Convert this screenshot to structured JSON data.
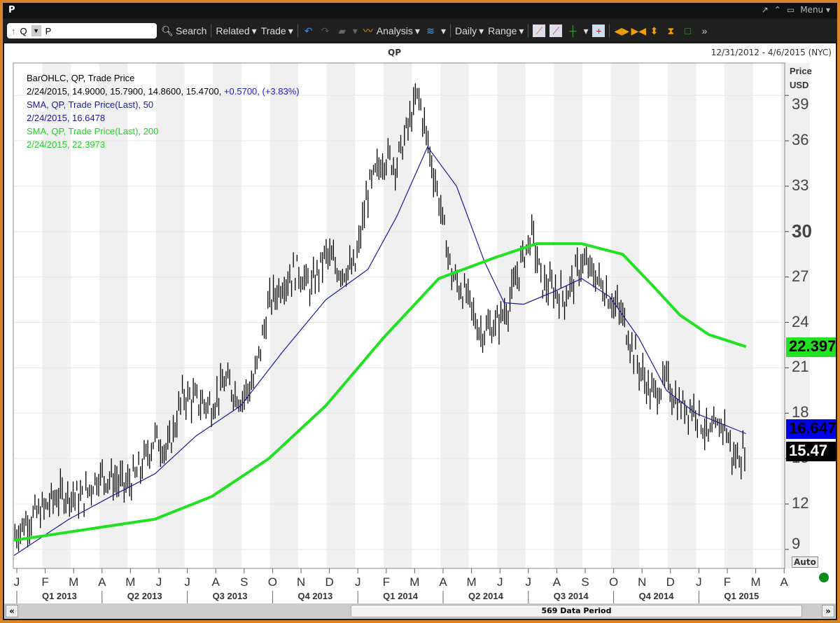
{
  "window": {
    "title": "P",
    "controls": [
      "↗",
      "⌃",
      "▭",
      "Menu ▾"
    ]
  },
  "toolbar": {
    "ticker_prefix": "Q",
    "ticker_value": "P",
    "search": "Search",
    "related": "Related",
    "trade": "Trade",
    "analysis": "Analysis",
    "daily": "Daily",
    "range": "Range"
  },
  "header": {
    "symbol": "QP",
    "date_range": "12/31/2012 - 4/6/2015 (NYC)"
  },
  "legend": {
    "l1": "BarOHLC, QP, Trade Price",
    "l2a": "2/24/2015, 14.9000, 15.7900, 14.8600, 15.4700, ",
    "l2b": "+0.5700, (+3.83%)",
    "l3": "SMA, QP, Trade Price(Last),  50",
    "l4": "2/24/2015, 16.6478",
    "l5": "SMA, QP, Trade Price(Last),  200",
    "l6": "2/24/2015, 22.3973"
  },
  "axis": {
    "price_label": "Price",
    "currency": "USD",
    "auto": "Auto",
    "badge_sma200": "22.397",
    "badge_sma50": "16.647",
    "badge_last": "15.47"
  },
  "scrollbar": {
    "label": "569 Data Period"
  },
  "colors": {
    "sma200": "#22e022",
    "sma50": "#1a1aa0",
    "price": "#000000",
    "change": "#1a1acc"
  },
  "chart_data": {
    "type": "ohlc-bar-line",
    "title": "QP",
    "ylabel": "Price USD",
    "ylim": [
      9,
      40
    ],
    "xlim": [
      "2012-12-31",
      "2015-04-06"
    ],
    "y_ticks": [
      9,
      12,
      15,
      18,
      21,
      24,
      27,
      30,
      33,
      36,
      39
    ],
    "month_ticks": [
      "J",
      "F",
      "M",
      "A",
      "M",
      "J",
      "J",
      "A",
      "S",
      "O",
      "N",
      "D",
      "J",
      "F",
      "M",
      "A",
      "M",
      "J",
      "J",
      "A",
      "S",
      "O",
      "N",
      "D",
      "J",
      "F",
      "M",
      "A"
    ],
    "quarter_ticks": [
      "Q1 2013",
      "Q2 2013",
      "Q3 2013",
      "Q4 2013",
      "Q1 2014",
      "Q2 2014",
      "Q3 2014",
      "Q4 2014",
      "Q1 2015"
    ],
    "grid": "alternating month shading",
    "series": [
      {
        "name": "BarOHLC, QP, Trade Price",
        "kind": "close",
        "points": [
          [
            "2013-01-02",
            10
          ],
          [
            "2013-01-15",
            10.9
          ],
          [
            "2013-02-01",
            11.6
          ],
          [
            "2013-02-15",
            12.5
          ],
          [
            "2013-03-01",
            12.7
          ],
          [
            "2013-03-15",
            12.3
          ],
          [
            "2013-04-01",
            13.9
          ],
          [
            "2013-04-15",
            13.7
          ],
          [
            "2013-05-01",
            13.2
          ],
          [
            "2013-05-15",
            14.1
          ],
          [
            "2013-06-01",
            16.4
          ],
          [
            "2013-06-15",
            15.5
          ],
          [
            "2013-07-01",
            19.2
          ],
          [
            "2013-07-15",
            18.8
          ],
          [
            "2013-08-01",
            18.5
          ],
          [
            "2013-08-15",
            20.1
          ],
          [
            "2013-09-01",
            19
          ],
          [
            "2013-09-15",
            20.1
          ],
          [
            "2013-10-01",
            25.2
          ],
          [
            "2013-10-15",
            26.6
          ],
          [
            "2013-11-01",
            27.5
          ],
          [
            "2013-11-15",
            26.2
          ],
          [
            "2013-12-01",
            28.5
          ],
          [
            "2013-12-15",
            27.5
          ],
          [
            "2014-01-01",
            27.5
          ],
          [
            "2014-01-15",
            32.6
          ],
          [
            "2014-02-01",
            35
          ],
          [
            "2014-02-15",
            34.5
          ],
          [
            "2014-03-01",
            37.3
          ],
          [
            "2014-03-10",
            39.1
          ],
          [
            "2014-03-20",
            35.9
          ],
          [
            "2014-04-01",
            32.2
          ],
          [
            "2014-04-15",
            27.1
          ],
          [
            "2014-05-01",
            25.7
          ],
          [
            "2014-05-15",
            23.4
          ],
          [
            "2014-06-01",
            23.8
          ],
          [
            "2014-06-15",
            25.2
          ],
          [
            "2014-07-01",
            28.5
          ],
          [
            "2014-07-10",
            29.9
          ],
          [
            "2014-07-20",
            26.6
          ],
          [
            "2014-08-01",
            26.2
          ],
          [
            "2014-08-15",
            25.7
          ],
          [
            "2014-09-01",
            28
          ],
          [
            "2014-09-15",
            27.1
          ],
          [
            "2014-10-01",
            25.7
          ],
          [
            "2014-10-15",
            24.3
          ],
          [
            "2014-11-01",
            21.1
          ],
          [
            "2014-11-15",
            19.2
          ],
          [
            "2014-12-01",
            20.1
          ],
          [
            "2014-12-15",
            18.5
          ],
          [
            "2015-01-01",
            18.3
          ],
          [
            "2015-01-15",
            16.4
          ],
          [
            "2015-02-01",
            17.4
          ],
          [
            "2015-02-10",
            15
          ],
          [
            "2015-02-24",
            15.47
          ]
        ]
      },
      {
        "name": "SMA, QP, Trade Price(Last), 50",
        "kind": "line",
        "points": [
          [
            "2013-01-01",
            8.6
          ],
          [
            "2013-03-01",
            11
          ],
          [
            "2013-04-15",
            12.5
          ],
          [
            "2013-06-01",
            14
          ],
          [
            "2013-07-15",
            16.5
          ],
          [
            "2013-09-01",
            18.5
          ],
          [
            "2013-10-15",
            22
          ],
          [
            "2013-12-01",
            25.5
          ],
          [
            "2014-01-15",
            27.5
          ],
          [
            "2014-02-15",
            31
          ],
          [
            "2014-03-20",
            35.6
          ],
          [
            "2014-04-20",
            33
          ],
          [
            "2014-05-20",
            28
          ],
          [
            "2014-06-10",
            25.3
          ],
          [
            "2014-07-01",
            25.2
          ],
          [
            "2014-08-01",
            26
          ],
          [
            "2014-09-01",
            26.9
          ],
          [
            "2014-10-01",
            25.7
          ],
          [
            "2014-11-01",
            23
          ],
          [
            "2014-12-01",
            19.5
          ],
          [
            "2015-01-01",
            18
          ],
          [
            "2015-02-24",
            16.65
          ]
        ]
      },
      {
        "name": "SMA, QP, Trade Price(Last), 200",
        "kind": "line",
        "points": [
          [
            "2013-01-01",
            9.6
          ],
          [
            "2013-06-01",
            11
          ],
          [
            "2013-08-01",
            12.5
          ],
          [
            "2013-10-01",
            15
          ],
          [
            "2013-12-01",
            18.5
          ],
          [
            "2014-02-01",
            23
          ],
          [
            "2014-04-01",
            26.9
          ],
          [
            "2014-06-01",
            28.3
          ],
          [
            "2014-07-15",
            29.2
          ],
          [
            "2014-09-01",
            29.2
          ],
          [
            "2014-10-15",
            28.5
          ],
          [
            "2014-11-15",
            26.5
          ],
          [
            "2014-12-15",
            24.5
          ],
          [
            "2015-01-15",
            23.2
          ],
          [
            "2015-02-24",
            22.4
          ]
        ]
      }
    ]
  }
}
